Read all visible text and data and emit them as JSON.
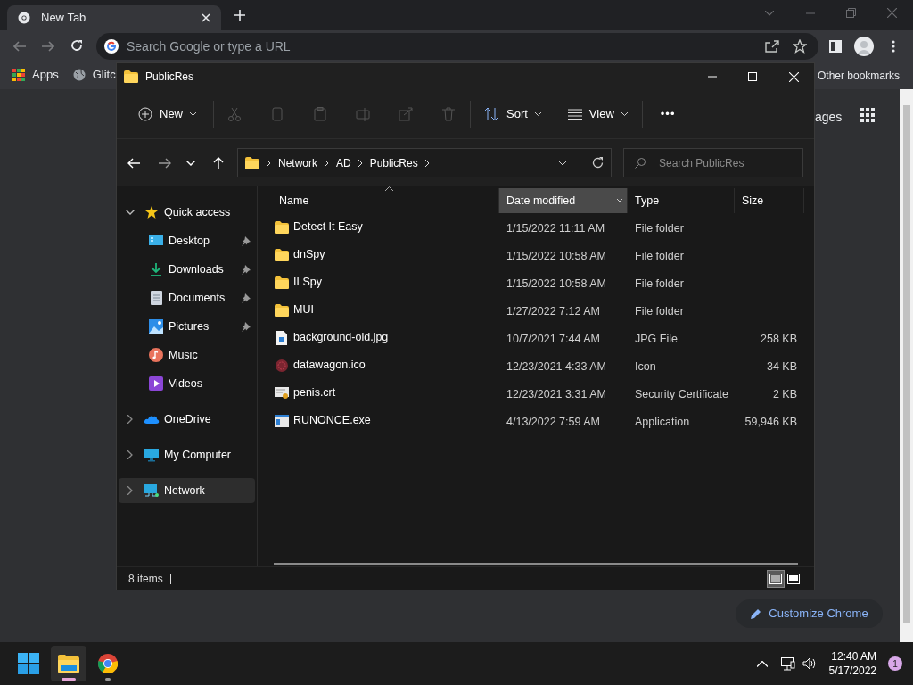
{
  "browser": {
    "tab": {
      "title": "New Tab"
    },
    "address_bar": {
      "placeholder": "Search Google or type a URL"
    },
    "bookmarks": [
      {
        "label": "Apps"
      },
      {
        "label": "Glitc"
      }
    ],
    "other_bookmarks": "Other bookmarks",
    "page_link": "ages",
    "customize_button": "Customize Chrome"
  },
  "explorer": {
    "title": "PublicRes",
    "toolbar": {
      "new": "New",
      "sort": "Sort",
      "view": "View",
      "more": "•••"
    },
    "breadcrumb": [
      "Network",
      "AD",
      "PublicRes"
    ],
    "search": {
      "placeholder": "Search PublicRes"
    },
    "sidebar": [
      {
        "label": "Quick access",
        "expanded": true,
        "selected": false,
        "children": [
          {
            "label": "Desktop",
            "pinned": true
          },
          {
            "label": "Downloads",
            "pinned": true
          },
          {
            "label": "Documents",
            "pinned": true
          },
          {
            "label": "Pictures",
            "pinned": true
          },
          {
            "label": "Music",
            "pinned": false
          },
          {
            "label": "Videos",
            "pinned": false
          }
        ]
      },
      {
        "label": "OneDrive",
        "expanded": false,
        "selected": false
      },
      {
        "label": "My Computer",
        "expanded": false,
        "selected": false
      },
      {
        "label": "Network",
        "expanded": false,
        "selected": true
      }
    ],
    "columns": [
      {
        "label": "Name",
        "sorted": true,
        "hovered": false
      },
      {
        "label": "Date modified",
        "sorted": false,
        "hovered": true
      },
      {
        "label": "Type",
        "sorted": false,
        "hovered": false
      },
      {
        "label": "Size",
        "sorted": false,
        "hovered": false
      }
    ],
    "rows": [
      {
        "kind": "folder",
        "name": "Detect It Easy",
        "date": "1/15/2022 11:11 AM",
        "type": "File folder"
      },
      {
        "kind": "folder",
        "name": "dnSpy",
        "date": "1/15/2022 10:58 AM",
        "type": "File folder"
      },
      {
        "kind": "folder",
        "name": "ILSpy",
        "date": "1/15/2022 10:58 AM",
        "type": "File folder"
      },
      {
        "kind": "folder",
        "name": "MUI",
        "date": "1/27/2022 7:12 AM",
        "type": "File folder"
      },
      {
        "kind": "image",
        "name": "background-old.jpg",
        "date": "10/7/2021 7:44 AM",
        "type": "JPG File",
        "size": "258 KB"
      },
      {
        "kind": "icon",
        "name": "datawagon.ico",
        "date": "12/23/2021 4:33 AM",
        "type": "Icon",
        "size": "34 KB"
      },
      {
        "kind": "certificate",
        "name": "penis.crt",
        "date": "12/23/2021 3:31 AM",
        "type": "Security Certificate",
        "size": "2 KB"
      },
      {
        "kind": "application",
        "name": "RUNONCE.exe",
        "date": "4/13/2022 7:59 AM",
        "type": "Application",
        "size": "59,946 KB"
      }
    ],
    "status": "8 items",
    "views": [
      {
        "selected": true
      },
      {
        "selected": false
      }
    ]
  },
  "taskbar": {
    "apps": [
      {
        "selected": true
      },
      {
        "selected": false
      }
    ],
    "time": "12:40 AM",
    "date": "5/17/2022",
    "notifications": "1"
  }
}
